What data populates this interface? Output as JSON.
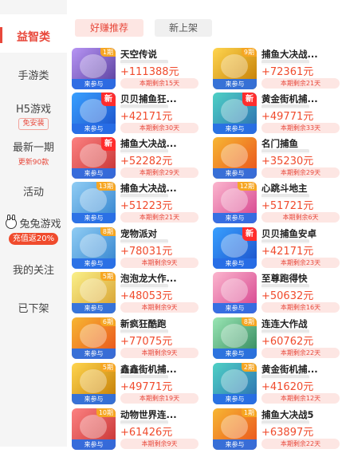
{
  "sidebar": {
    "items": [
      {
        "label": "益智类"
      },
      {
        "label": "手游类"
      },
      {
        "label": "H5游戏",
        "badge": "免安装"
      },
      {
        "label": "最新一期",
        "sub": "更新90款"
      },
      {
        "label": "活动"
      },
      {
        "label": "兔兔游戏",
        "badge": "充值返20%"
      },
      {
        "label": "我的关注"
      },
      {
        "label": "已下架"
      }
    ]
  },
  "tabs": [
    {
      "label": "好赚推荐"
    },
    {
      "label": "新上架"
    }
  ],
  "games": [
    {
      "title": "天空传说",
      "amount": "+111388元",
      "remain": "本期剩余15天",
      "period": "1期",
      "new": false,
      "color": "c-purple"
    },
    {
      "title": "捕鱼大决战...",
      "amount": "+72361元",
      "remain": "本期剩余21天",
      "period": "9期",
      "new": false,
      "color": "c-gold"
    },
    {
      "title": "贝贝捕鱼狂...",
      "amount": "+42171元",
      "remain": "本期剩余30天",
      "period": "",
      "new": true,
      "color": "c-blue"
    },
    {
      "title": "黄金街机捕...",
      "amount": "+49771元",
      "remain": "本期剩余33天",
      "period": "",
      "new": true,
      "color": "c-teal"
    },
    {
      "title": "捕鱼大决战...",
      "amount": "+52282元",
      "remain": "本期剩余29天",
      "period": "",
      "new": true,
      "color": "c-red"
    },
    {
      "title": "名门捕鱼",
      "amount": "+35230元",
      "remain": "本期剩余29天",
      "period": "",
      "new": false,
      "color": "c-orange"
    },
    {
      "title": "捕鱼大决战...",
      "amount": "+51223元",
      "remain": "本期剩余21天",
      "period": "13期",
      "new": false,
      "color": "c-sky"
    },
    {
      "title": "心跳斗地主",
      "amount": "+51721元",
      "remain": "本期剩余6天",
      "period": "12期",
      "new": false,
      "color": "c-pink"
    },
    {
      "title": "宠物派对",
      "amount": "+78031元",
      "remain": "本期剩余9天",
      "period": "8期",
      "new": false,
      "color": "c-sky"
    },
    {
      "title": "贝贝捕鱼安卓",
      "amount": "+42171元",
      "remain": "本期剩余23天",
      "period": "",
      "new": true,
      "color": "c-blue"
    },
    {
      "title": "泡泡龙大作...",
      "amount": "+48053元",
      "remain": "本期剩余9天",
      "period": "5期",
      "new": false,
      "color": "c-yellow"
    },
    {
      "title": "至尊跑得快",
      "amount": "+50632元",
      "remain": "本期剩余16天",
      "period": "",
      "new": false,
      "color": "c-pink"
    },
    {
      "title": "新疯狂酷跑",
      "amount": "+77075元",
      "remain": "本期剩余9天",
      "period": "6期",
      "new": false,
      "color": "c-orange"
    },
    {
      "title": "连连大作战",
      "amount": "+60762元",
      "remain": "本期剩余22天",
      "period": "8期",
      "new": false,
      "color": "c-green"
    },
    {
      "title": "鑫鑫街机捕...",
      "amount": "+49771元",
      "remain": "本期剩余19天",
      "period": "5期",
      "new": false,
      "color": "c-gold"
    },
    {
      "title": "黄金街机捕...",
      "amount": "+41620元",
      "remain": "本期剩余12天",
      "period": "2期",
      "new": false,
      "color": "c-teal"
    },
    {
      "title": "动物世界连...",
      "amount": "+61426元",
      "remain": "本期剩余9天",
      "period": "10期",
      "new": false,
      "color": "c-red"
    },
    {
      "title": "捕鱼大决战5",
      "amount": "+63897元",
      "remain": "本期剩余22天",
      "period": "1期",
      "new": false,
      "color": "c-orange"
    }
  ],
  "join_label": "来参与"
}
